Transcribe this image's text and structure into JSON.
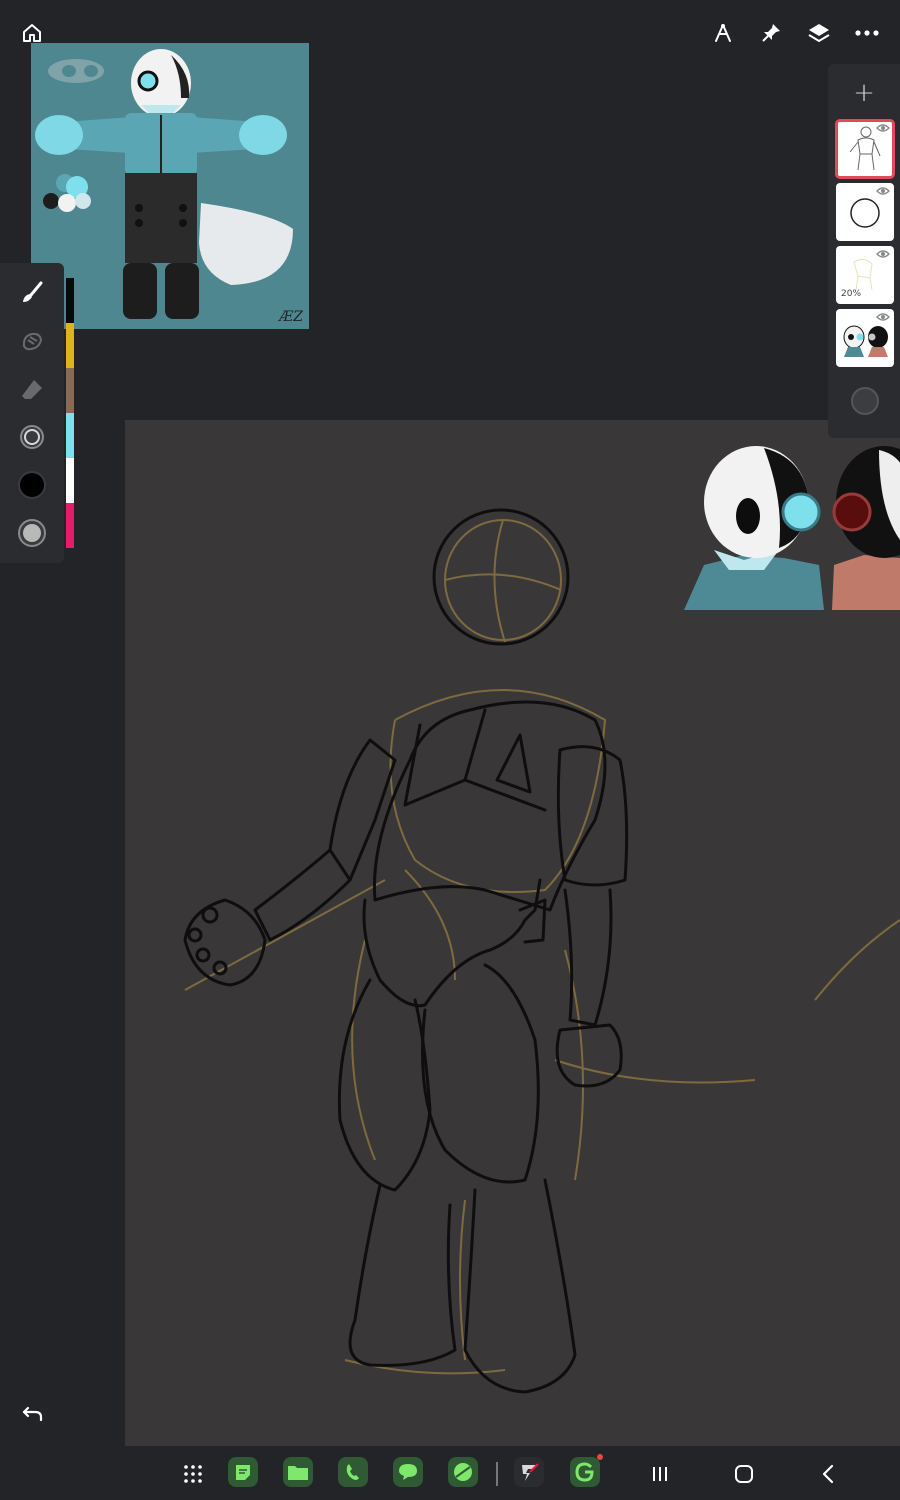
{
  "app": {
    "name": "drawing-app"
  },
  "top_toolbar": {
    "home_icon": "home-icon",
    "ruler_icon": "compass-ruler-icon",
    "pin_icon": "pin-icon",
    "layers_icon": "layers-icon",
    "more_icon": "more-horizontal-icon"
  },
  "reference": {
    "signature": "ÆZ"
  },
  "tools": [
    {
      "name": "brush",
      "icon": "brush-icon",
      "active": true
    },
    {
      "name": "smudge",
      "icon": "smudge-icon",
      "active": false
    },
    {
      "name": "eraser",
      "icon": "eraser-icon",
      "active": false
    },
    {
      "name": "brush-size",
      "icon": "size-circle-icon",
      "active": false
    },
    {
      "name": "color",
      "icon": "color-black-icon",
      "active": false
    },
    {
      "name": "opacity",
      "icon": "opacity-circle-icon",
      "active": false
    }
  ],
  "palette": [
    "#0a0a0a",
    "#e2b21e",
    "#8a6a52",
    "#7ee0ec",
    "#ffffff",
    "#e81a6a"
  ],
  "layers": {
    "add_label": "+",
    "items": [
      {
        "name": "sketch-line-layer",
        "selected": true,
        "visible": true,
        "opacity": ""
      },
      {
        "name": "circle-layer",
        "selected": false,
        "visible": true,
        "opacity": ""
      },
      {
        "name": "rough-layer",
        "selected": false,
        "visible": true,
        "opacity": "20%"
      },
      {
        "name": "reference-layer",
        "selected": false,
        "visible": true,
        "opacity": ""
      }
    ]
  },
  "undo_icon": "undo-icon",
  "taskbar": {
    "apps": [
      "app-drawer-icon",
      "notes-icon",
      "files-icon",
      "phone-icon",
      "messages-icon",
      "browser-icon",
      "flashscore-icon",
      "grammarly-icon"
    ],
    "nav": [
      "recents-icon",
      "home-circle-icon",
      "back-icon"
    ]
  },
  "colors": {
    "canvas": "#3a3739",
    "background": "#232428",
    "selected_layer": "#e04a5a"
  }
}
